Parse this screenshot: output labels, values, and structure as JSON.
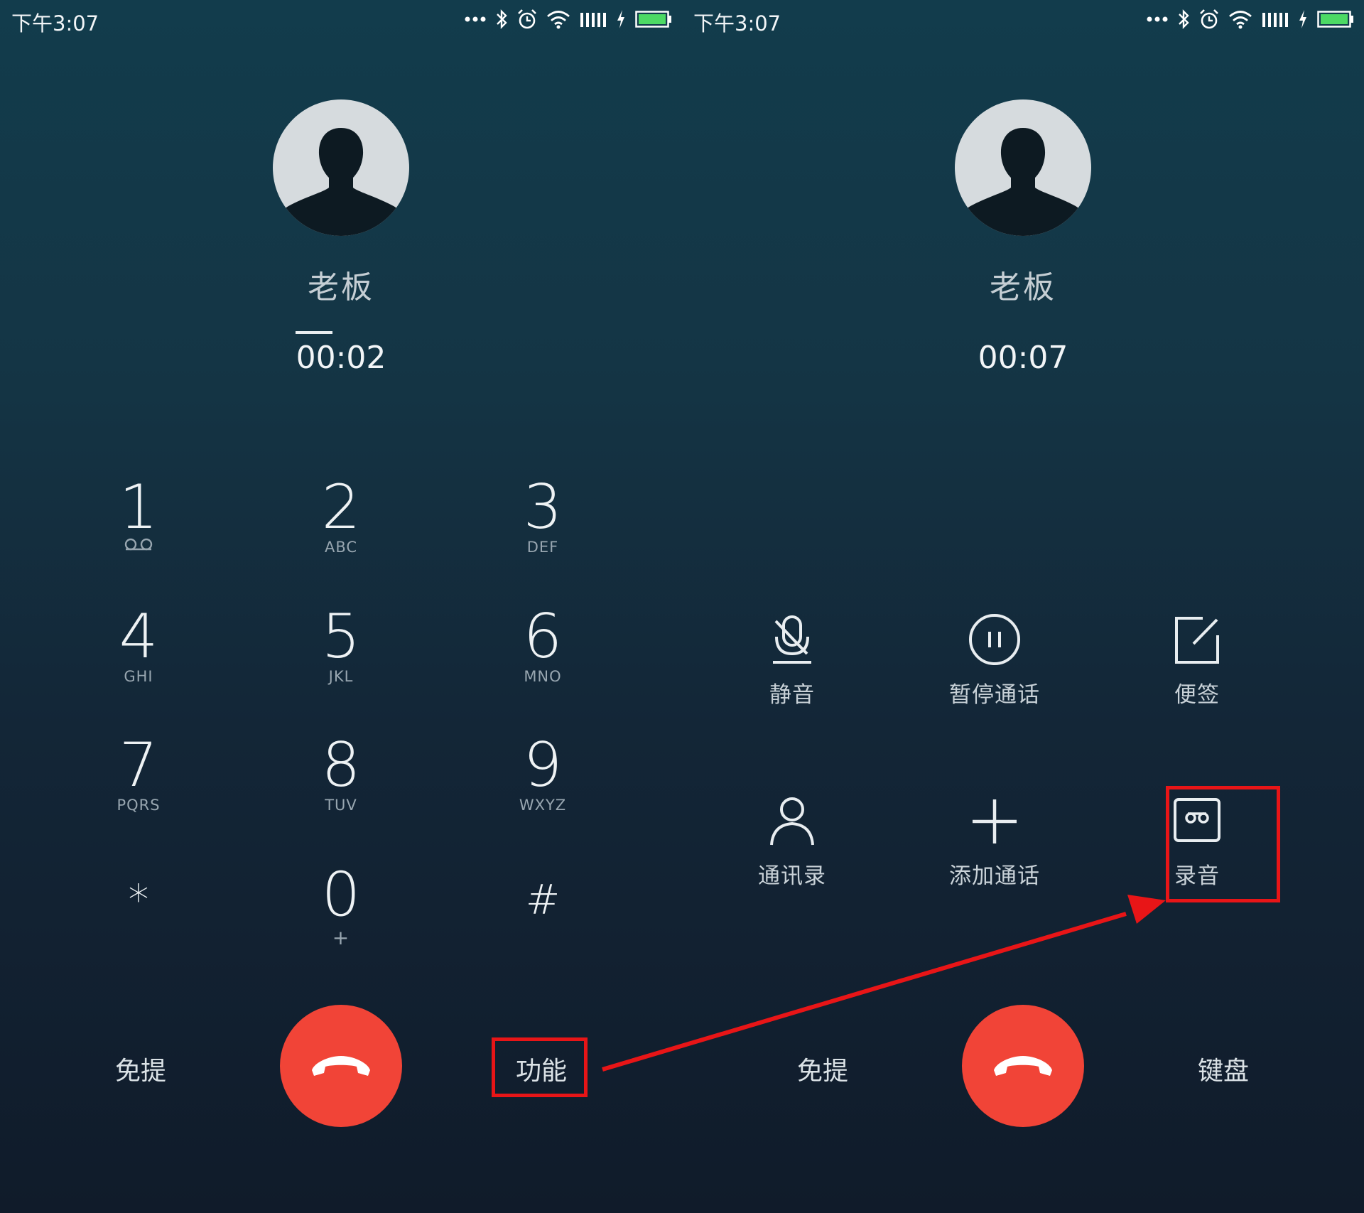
{
  "left_screen": {
    "status": {
      "time": "下午3:07"
    },
    "contact": {
      "name": "老板"
    },
    "call": {
      "timer": "00:02"
    },
    "keypad": [
      {
        "digit": "1",
        "letters": "",
        "icon": "voicemail-icon"
      },
      {
        "digit": "2",
        "letters": "ABC"
      },
      {
        "digit": "3",
        "letters": "DEF"
      },
      {
        "digit": "4",
        "letters": "GHI"
      },
      {
        "digit": "5",
        "letters": "JKL"
      },
      {
        "digit": "6",
        "letters": "MNO"
      },
      {
        "digit": "7",
        "letters": "PQRS"
      },
      {
        "digit": "8",
        "letters": "TUV"
      },
      {
        "digit": "9",
        "letters": "WXYZ"
      },
      {
        "digit": "*",
        "letters": ""
      },
      {
        "digit": "0",
        "letters": "+"
      },
      {
        "digit": "#",
        "letters": ""
      }
    ],
    "bottom": {
      "speaker_label": "免提",
      "functions_label": "功能"
    }
  },
  "right_screen": {
    "status": {
      "time": "下午3:07"
    },
    "contact": {
      "name": "老板"
    },
    "call": {
      "timer": "00:07"
    },
    "functions": [
      {
        "label": "静音",
        "icon": "mute-mic-icon"
      },
      {
        "label": "暂停通话",
        "icon": "pause-icon"
      },
      {
        "label": "便签",
        "icon": "note-icon"
      },
      {
        "label": "通讯录",
        "icon": "contacts-icon"
      },
      {
        "label": "添加通话",
        "icon": "add-call-icon"
      },
      {
        "label": "录音",
        "icon": "record-icon"
      }
    ],
    "bottom": {
      "speaker_label": "免提",
      "keypad_label": "键盘"
    }
  },
  "colors": {
    "bg_top": "#123c4c",
    "bg_bottom": "#101b2a",
    "hangup": "#f14437",
    "highlight": "#e81517",
    "battery": "#4cd964"
  }
}
